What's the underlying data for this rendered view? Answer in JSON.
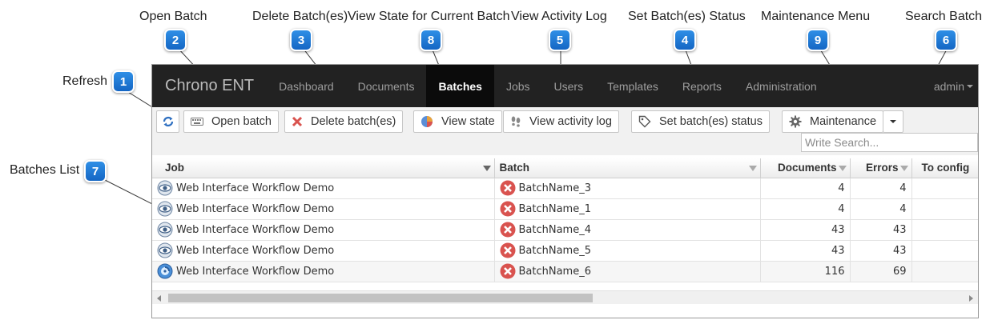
{
  "callouts": [
    {
      "label": "Refresh",
      "number": "1"
    },
    {
      "label": "Open Batch",
      "number": "2"
    },
    {
      "label": "Delete Batch(es)",
      "number": "3"
    },
    {
      "label": "Set Batch(es) Status",
      "number": "4"
    },
    {
      "label": "View Activity Log",
      "number": "5"
    },
    {
      "label": "Search Batch",
      "number": "6"
    },
    {
      "label": "Batches List",
      "number": "7"
    },
    {
      "label": "View State for Current Batch",
      "number": "8"
    },
    {
      "label": "Maintenance Menu",
      "number": "9"
    }
  ],
  "navbar": {
    "brand": "Chrono ENT",
    "items": [
      "Dashboard",
      "Documents",
      "Batches",
      "Jobs",
      "Users",
      "Templates",
      "Reports",
      "Administration"
    ],
    "active": "Batches",
    "user": "admin"
  },
  "toolbar": {
    "open_label": "Open batch",
    "delete_label": "Delete batch(es)",
    "view_state_label": "View state",
    "activity_label": "View activity log",
    "set_status_label": "Set batch(es) status",
    "maintenance_label": "Maintenance"
  },
  "search": {
    "placeholder": "Write Search...",
    "value": ""
  },
  "grid": {
    "columns": [
      "Job",
      "Batch",
      "Documents",
      "Errors",
      "To config"
    ],
    "rows": [
      {
        "job": "Web Interface Workflow Demo",
        "batch": "BatchName_3",
        "documents": "4",
        "errors": "4",
        "job_icon": "eye-icon"
      },
      {
        "job": "Web Interface Workflow Demo",
        "batch": "BatchName_1",
        "documents": "4",
        "errors": "4",
        "job_icon": "eye-icon"
      },
      {
        "job": "Web Interface Workflow Demo",
        "batch": "BatchName_4",
        "documents": "43",
        "errors": "43",
        "job_icon": "eye-icon"
      },
      {
        "job": "Web Interface Workflow Demo",
        "batch": "BatchName_5",
        "documents": "43",
        "errors": "43",
        "job_icon": "eye-icon"
      },
      {
        "job": "Web Interface Workflow Demo",
        "batch": "BatchName_6",
        "documents": "116",
        "errors": "69",
        "job_icon": "disc-icon"
      }
    ]
  },
  "colors": {
    "badge": "#1a72d4",
    "navbar": "#222222",
    "error_icon": "#d9534f"
  }
}
